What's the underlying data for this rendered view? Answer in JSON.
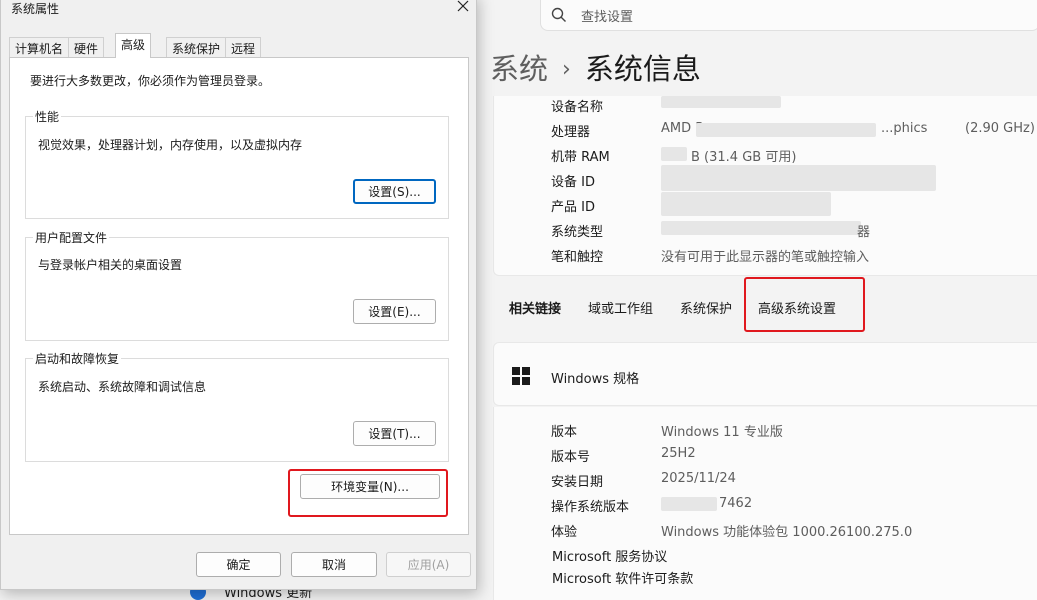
{
  "settings": {
    "search_placeholder": "查找设置",
    "breadcrumb": {
      "parent": "系统",
      "separator": "›",
      "current": "系统信息"
    },
    "device_specs": [
      {
        "key": "设备名称",
        "value": "",
        "value_extra": ""
      },
      {
        "key": "处理器",
        "value": "AMD R",
        "value_mid": "...phics",
        "value_extra": "(2.90 GHz)"
      },
      {
        "key": "机带 RAM",
        "value": "B (31.4 GB 可用)",
        "value_extra": ""
      },
      {
        "key": "设备 ID",
        "value": "",
        "value_extra": ""
      },
      {
        "key": "产品 ID",
        "value": "",
        "value_extra": ""
      },
      {
        "key": "系统类型",
        "value": "器",
        "value_extra": ""
      },
      {
        "key": "笔和触控",
        "value": "没有可用于此显示器的笔或触控输入",
        "value_extra": ""
      }
    ],
    "related_links": {
      "title": "相关链接",
      "items": [
        "域或工作组",
        "系统保护",
        "高级系统设置"
      ]
    },
    "windows_spec": {
      "title": "Windows 规格",
      "rows": [
        {
          "key": "版本",
          "value": "Windows 11 专业版"
        },
        {
          "key": "版本号",
          "value": "25H2"
        },
        {
          "key": "安装日期",
          "value": "2025/11/24"
        },
        {
          "key": "操作系统版本",
          "value": "7462"
        },
        {
          "key": "体验",
          "value": "Windows 功能体验包 1000.26100.275.0"
        }
      ],
      "links": [
        "Microsoft 服务协议",
        "Microsoft 软件许可条款"
      ]
    },
    "update_peek": "Windows 更新"
  },
  "dialog": {
    "title": "系统属性",
    "tabs": [
      "计算机名",
      "硬件",
      "高级",
      "系统保护",
      "远程"
    ],
    "active_tab": "高级",
    "admin_note": "要进行大多数更改，你必须作为管理员登录。",
    "groups": [
      {
        "legend": "性能",
        "desc": "视觉效果，处理器计划，内存使用，以及虚拟内存",
        "button": "设置(S)..."
      },
      {
        "legend": "用户配置文件",
        "desc": "与登录帐户相关的桌面设置",
        "button": "设置(E)..."
      },
      {
        "legend": "启动和故障恢复",
        "desc": "系统启动、系统故障和调试信息",
        "button": "设置(T)..."
      }
    ],
    "env_button": "环境变量(N)...",
    "footer": {
      "ok": "确定",
      "cancel": "取消",
      "apply": "应用(A)"
    }
  },
  "colors": {
    "highlight_red": "#e0181e",
    "focus_blue": "#0067c0"
  }
}
